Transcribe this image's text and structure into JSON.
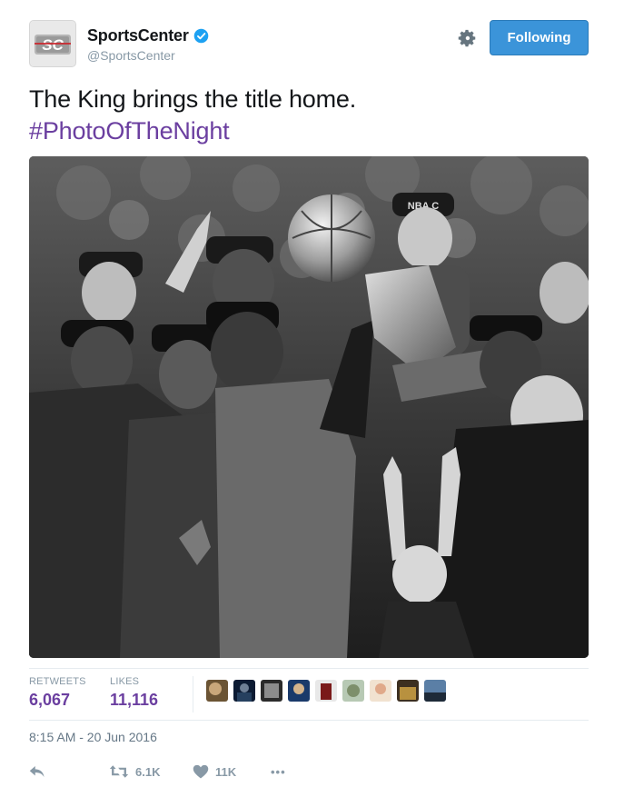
{
  "account": {
    "display_name": "SportsCenter",
    "handle": "@SportsCenter",
    "verified": true,
    "avatar_text": "SC",
    "following_label": "Following"
  },
  "tweet": {
    "text": "The King brings the title home.",
    "hashtag": "#PhotoOfTheNight",
    "timestamp": "8:15 AM - 20 Jun 2016"
  },
  "stats": {
    "retweets_label": "RETWEETS",
    "retweets_value": "6,067",
    "likes_label": "LIKES",
    "likes_value": "11,116"
  },
  "actions": {
    "retweet_count": "6.1K",
    "like_count": "11K",
    "more_label": "•••"
  },
  "photo": {
    "cap_logo_text": "NBA C",
    "icons": [
      "gear-icon",
      "verified-icon",
      "reply-icon",
      "retweet-icon",
      "heart-icon",
      "more-icon"
    ]
  },
  "colors": {
    "accent": "#6b3fa0",
    "follow_button": "#3b94d9",
    "muted": "#8899a6",
    "text": "#14171a"
  }
}
